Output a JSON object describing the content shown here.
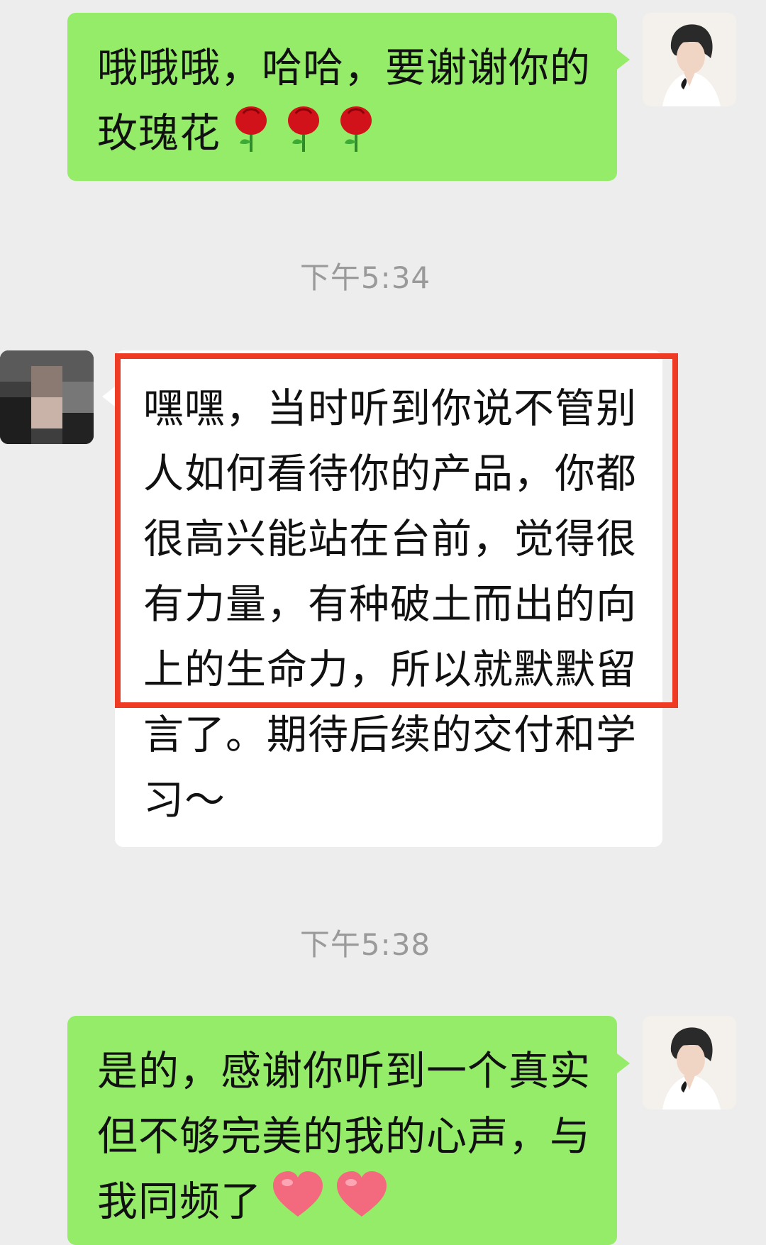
{
  "messages": [
    {
      "side": "me",
      "text": "哦哦哦，哈哈，要谢谢你的玫瑰花",
      "emoji": "rose-icon",
      "emoji_count": 3
    },
    {
      "timestamp": "下午5:34"
    },
    {
      "side": "other",
      "text": "嘿嘿，当时听到你说不管别人如何看待你的产品，你都很高兴能站在台前，觉得很有力量，有种破土而出的向上的生命力，所以就默默留言了。期待后续的交付和学习～"
    },
    {
      "timestamp": "下午5:38"
    },
    {
      "side": "me",
      "text": "是的，感谢你听到一个真实但不够完美的我的心声，与我同频了",
      "emoji": "heart-icon",
      "emoji_count": 2
    }
  ],
  "colors": {
    "background": "#ededed",
    "bubble_me": "#95ec69",
    "bubble_other": "#ffffff",
    "timestamp": "#9a9a9a",
    "highlight": "#f03b24"
  }
}
